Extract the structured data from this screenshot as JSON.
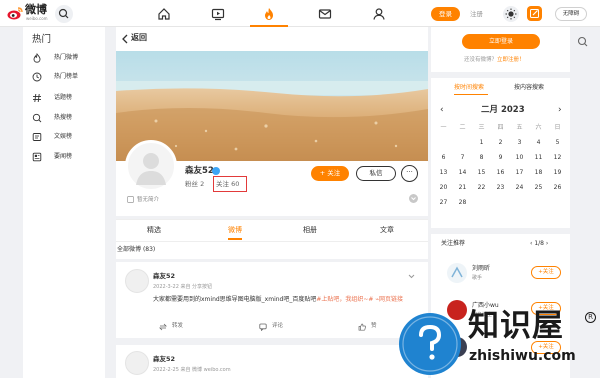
{
  "header": {
    "logo_text": "微博",
    "logo_url": "weibo.com",
    "login_label": "登录",
    "register_label": "注册",
    "accessibility_label": "无障碍",
    "nav_icons": [
      "home-icon",
      "video-icon",
      "hot-icon",
      "mail-icon",
      "user-icon"
    ],
    "accent_color": "#ff8200"
  },
  "sidebar": {
    "title": "热门",
    "items": [
      {
        "icon": "hot-weibo-icon",
        "label": "热门微博"
      },
      {
        "icon": "clock-icon",
        "label": "热门榜单"
      },
      {
        "icon": "topic-icon",
        "label": "话题榜"
      },
      {
        "icon": "search-hot-icon",
        "label": "热搜榜"
      },
      {
        "icon": "culture-icon",
        "label": "文娱榜"
      },
      {
        "icon": "news-icon",
        "label": "要闻榜"
      }
    ]
  },
  "main": {
    "back_label": "返回",
    "profile": {
      "name": "森友52",
      "fans_label": "粉丝",
      "fans_count": "2",
      "following_label": "关注",
      "following_count": "60",
      "intro": "暂无简介",
      "follow_button": "+ 关注",
      "message_button": "私信",
      "more_button": "···"
    },
    "tabs": [
      "精选",
      "微博",
      "相册",
      "文章"
    ],
    "active_tab": "微博",
    "all_weibo_label": "全部微博",
    "all_weibo_count": "(83)",
    "posts": [
      {
        "author": "森友52",
        "meta": "2022-3-22 来自 分享按钮",
        "text_plain": "大家都需要用到的xmind思维导图电脑版_xmind吧_百度贴吧",
        "text_link": "#上贴吧，我组织~#",
        "text_link2": "网页链接",
        "actions": [
          "转发",
          "评论",
          "赞"
        ]
      },
      {
        "author": "森友52",
        "meta": "2022-2-25 来自 微博 weibo.com"
      }
    ]
  },
  "right": {
    "login_button": "立即登录",
    "login_tip_prefix": "还没有微博？",
    "login_tip_link": "立即注册！",
    "calendar": {
      "tab_time": "按时间搜索",
      "tab_content": "按内容搜索",
      "month_label": "二月 2023",
      "weekdays": [
        "一",
        "二",
        "三",
        "四",
        "五",
        "六",
        "日"
      ],
      "weeks": [
        [
          "",
          "",
          "1",
          "2",
          "3",
          "4",
          "5"
        ],
        [
          "6",
          "7",
          "8",
          "9",
          "10",
          "11",
          "12"
        ],
        [
          "13",
          "14",
          "15",
          "16",
          "17",
          "18",
          "19"
        ],
        [
          "20",
          "21",
          "22",
          "23",
          "24",
          "25",
          "26"
        ],
        [
          "27",
          "28",
          "",
          "",
          "",
          "",
          ""
        ]
      ]
    },
    "recommend": {
      "title": "关注推荐",
      "pager": "1/8",
      "users": [
        {
          "name": "刘雨昕",
          "sub": "歌手",
          "button": "+关注"
        },
        {
          "name": "广西小wu",
          "sub": "知名博主",
          "button": "+关注"
        },
        {
          "name": "",
          "sub": "",
          "button": "+关注"
        }
      ]
    }
  },
  "watermark": {
    "text": "知识屋",
    "url": "zhishiwu.com",
    "registered": "R"
  }
}
